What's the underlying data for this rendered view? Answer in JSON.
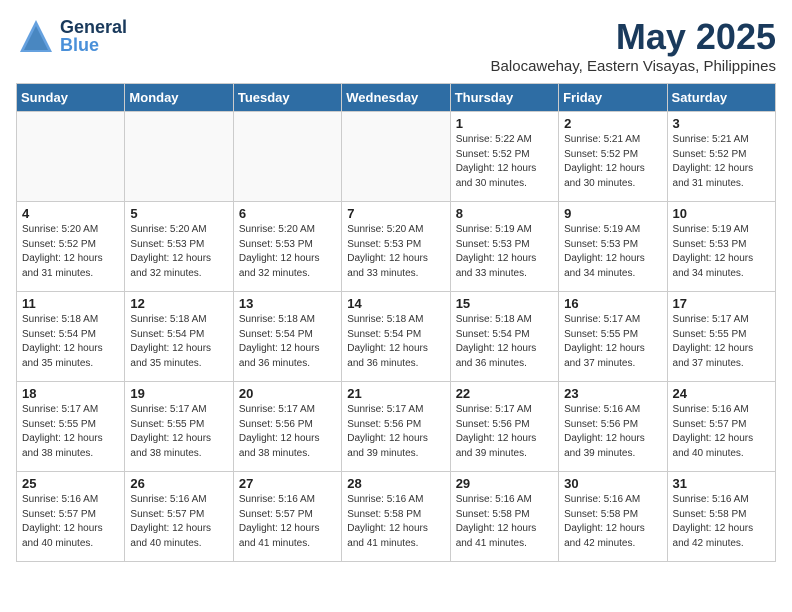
{
  "header": {
    "logo_general": "General",
    "logo_blue": "Blue",
    "month": "May 2025",
    "location": "Balocawehay, Eastern Visayas, Philippines"
  },
  "days_of_week": [
    "Sunday",
    "Monday",
    "Tuesday",
    "Wednesday",
    "Thursday",
    "Friday",
    "Saturday"
  ],
  "weeks": [
    [
      {
        "day": "",
        "detail": ""
      },
      {
        "day": "",
        "detail": ""
      },
      {
        "day": "",
        "detail": ""
      },
      {
        "day": "",
        "detail": ""
      },
      {
        "day": "1",
        "detail": "Sunrise: 5:22 AM\nSunset: 5:52 PM\nDaylight: 12 hours\nand 30 minutes."
      },
      {
        "day": "2",
        "detail": "Sunrise: 5:21 AM\nSunset: 5:52 PM\nDaylight: 12 hours\nand 30 minutes."
      },
      {
        "day": "3",
        "detail": "Sunrise: 5:21 AM\nSunset: 5:52 PM\nDaylight: 12 hours\nand 31 minutes."
      }
    ],
    [
      {
        "day": "4",
        "detail": "Sunrise: 5:20 AM\nSunset: 5:52 PM\nDaylight: 12 hours\nand 31 minutes."
      },
      {
        "day": "5",
        "detail": "Sunrise: 5:20 AM\nSunset: 5:53 PM\nDaylight: 12 hours\nand 32 minutes."
      },
      {
        "day": "6",
        "detail": "Sunrise: 5:20 AM\nSunset: 5:53 PM\nDaylight: 12 hours\nand 32 minutes."
      },
      {
        "day": "7",
        "detail": "Sunrise: 5:20 AM\nSunset: 5:53 PM\nDaylight: 12 hours\nand 33 minutes."
      },
      {
        "day": "8",
        "detail": "Sunrise: 5:19 AM\nSunset: 5:53 PM\nDaylight: 12 hours\nand 33 minutes."
      },
      {
        "day": "9",
        "detail": "Sunrise: 5:19 AM\nSunset: 5:53 PM\nDaylight: 12 hours\nand 34 minutes."
      },
      {
        "day": "10",
        "detail": "Sunrise: 5:19 AM\nSunset: 5:53 PM\nDaylight: 12 hours\nand 34 minutes."
      }
    ],
    [
      {
        "day": "11",
        "detail": "Sunrise: 5:18 AM\nSunset: 5:54 PM\nDaylight: 12 hours\nand 35 minutes."
      },
      {
        "day": "12",
        "detail": "Sunrise: 5:18 AM\nSunset: 5:54 PM\nDaylight: 12 hours\nand 35 minutes."
      },
      {
        "day": "13",
        "detail": "Sunrise: 5:18 AM\nSunset: 5:54 PM\nDaylight: 12 hours\nand 36 minutes."
      },
      {
        "day": "14",
        "detail": "Sunrise: 5:18 AM\nSunset: 5:54 PM\nDaylight: 12 hours\nand 36 minutes."
      },
      {
        "day": "15",
        "detail": "Sunrise: 5:18 AM\nSunset: 5:54 PM\nDaylight: 12 hours\nand 36 minutes."
      },
      {
        "day": "16",
        "detail": "Sunrise: 5:17 AM\nSunset: 5:55 PM\nDaylight: 12 hours\nand 37 minutes."
      },
      {
        "day": "17",
        "detail": "Sunrise: 5:17 AM\nSunset: 5:55 PM\nDaylight: 12 hours\nand 37 minutes."
      }
    ],
    [
      {
        "day": "18",
        "detail": "Sunrise: 5:17 AM\nSunset: 5:55 PM\nDaylight: 12 hours\nand 38 minutes."
      },
      {
        "day": "19",
        "detail": "Sunrise: 5:17 AM\nSunset: 5:55 PM\nDaylight: 12 hours\nand 38 minutes."
      },
      {
        "day": "20",
        "detail": "Sunrise: 5:17 AM\nSunset: 5:56 PM\nDaylight: 12 hours\nand 38 minutes."
      },
      {
        "day": "21",
        "detail": "Sunrise: 5:17 AM\nSunset: 5:56 PM\nDaylight: 12 hours\nand 39 minutes."
      },
      {
        "day": "22",
        "detail": "Sunrise: 5:17 AM\nSunset: 5:56 PM\nDaylight: 12 hours\nand 39 minutes."
      },
      {
        "day": "23",
        "detail": "Sunrise: 5:16 AM\nSunset: 5:56 PM\nDaylight: 12 hours\nand 39 minutes."
      },
      {
        "day": "24",
        "detail": "Sunrise: 5:16 AM\nSunset: 5:57 PM\nDaylight: 12 hours\nand 40 minutes."
      }
    ],
    [
      {
        "day": "25",
        "detail": "Sunrise: 5:16 AM\nSunset: 5:57 PM\nDaylight: 12 hours\nand 40 minutes."
      },
      {
        "day": "26",
        "detail": "Sunrise: 5:16 AM\nSunset: 5:57 PM\nDaylight: 12 hours\nand 40 minutes."
      },
      {
        "day": "27",
        "detail": "Sunrise: 5:16 AM\nSunset: 5:57 PM\nDaylight: 12 hours\nand 41 minutes."
      },
      {
        "day": "28",
        "detail": "Sunrise: 5:16 AM\nSunset: 5:58 PM\nDaylight: 12 hours\nand 41 minutes."
      },
      {
        "day": "29",
        "detail": "Sunrise: 5:16 AM\nSunset: 5:58 PM\nDaylight: 12 hours\nand 41 minutes."
      },
      {
        "day": "30",
        "detail": "Sunrise: 5:16 AM\nSunset: 5:58 PM\nDaylight: 12 hours\nand 42 minutes."
      },
      {
        "day": "31",
        "detail": "Sunrise: 5:16 AM\nSunset: 5:58 PM\nDaylight: 12 hours\nand 42 minutes."
      }
    ]
  ]
}
